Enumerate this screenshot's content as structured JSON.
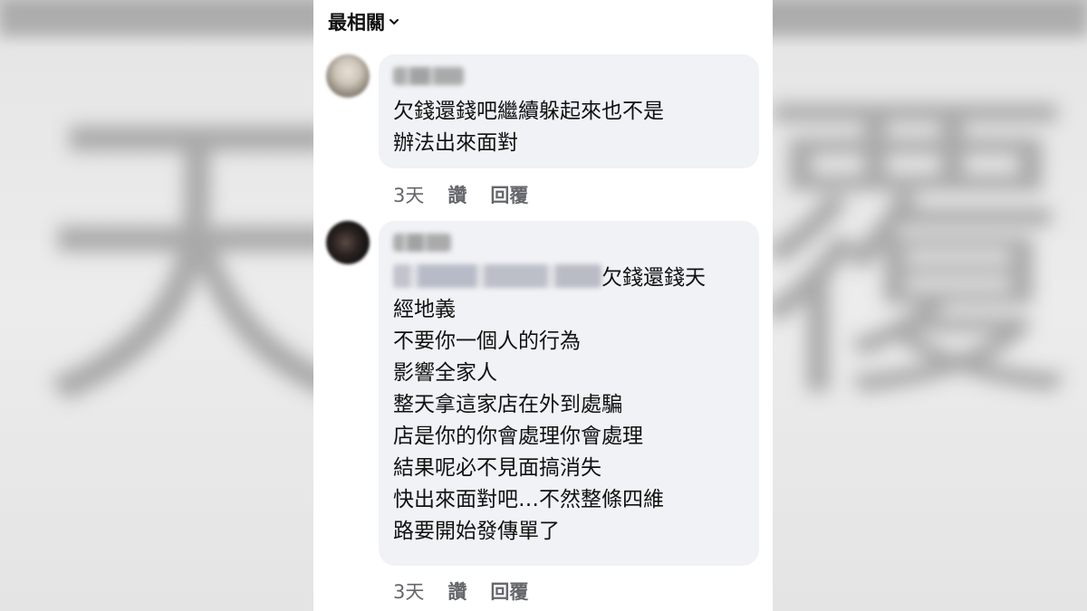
{
  "sort": {
    "label": "最相關"
  },
  "comments": [
    {
      "text": "欠錢還錢吧繼續躲起來也不是\n辦法出來面對",
      "time": "3天",
      "like": "讚",
      "reply": "回覆"
    },
    {
      "text_first_line_suffix": "欠錢還錢天",
      "text_rest": "經地義\n不要你一個人的行為\n影響全家人\n整天拿這家店在外到處騙\n店是你的你會處理你會處理\n結果呢必不見面搞消失\n快出來面對吧…不然整條四維\n路要開始發傳單了",
      "time": "3天",
      "like": "讚",
      "reply": "回覆"
    }
  ],
  "background": {
    "left_glyph": "天",
    "right_glyph": "覆"
  },
  "colors": {
    "bubble": "#f0f2f5",
    "meta_text": "#65676b",
    "panel": "#ffffff"
  }
}
